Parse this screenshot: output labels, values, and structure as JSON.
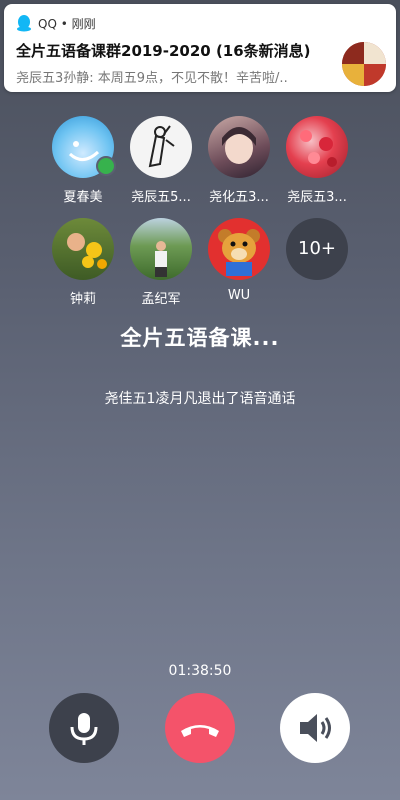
{
  "notification": {
    "app": "QQ • 刚刚",
    "title": "全片五语备课群2019-2020 (16条新消息)",
    "body": "尧辰五3孙静: 本周五9点，不见不散！辛苦啦/.."
  },
  "participants": [
    {
      "name": "夏春美",
      "avatar": "sky-blue-smile",
      "speaking": true
    },
    {
      "name": "尧辰五5...",
      "avatar": "sketch-drawing"
    },
    {
      "name": "尧化五3...",
      "avatar": "anime-girl"
    },
    {
      "name": "尧辰五3...",
      "avatar": "red-flowers"
    },
    {
      "name": "钟莉",
      "avatar": "child-with-flowers"
    },
    {
      "name": "孟纪军",
      "avatar": "man-outdoors"
    },
    {
      "name": "WU",
      "avatar": "pixel-bear"
    },
    {
      "name": "10+",
      "avatar": "more"
    }
  ],
  "group_name": "全片五语备课...",
  "event_text": "尧佳五1凌月凡退出了语音通话",
  "timer": "01:38:50",
  "colors": {
    "hangup": "#f4536a",
    "control_dark": "#3d414c",
    "speaking": "#37b24d"
  }
}
